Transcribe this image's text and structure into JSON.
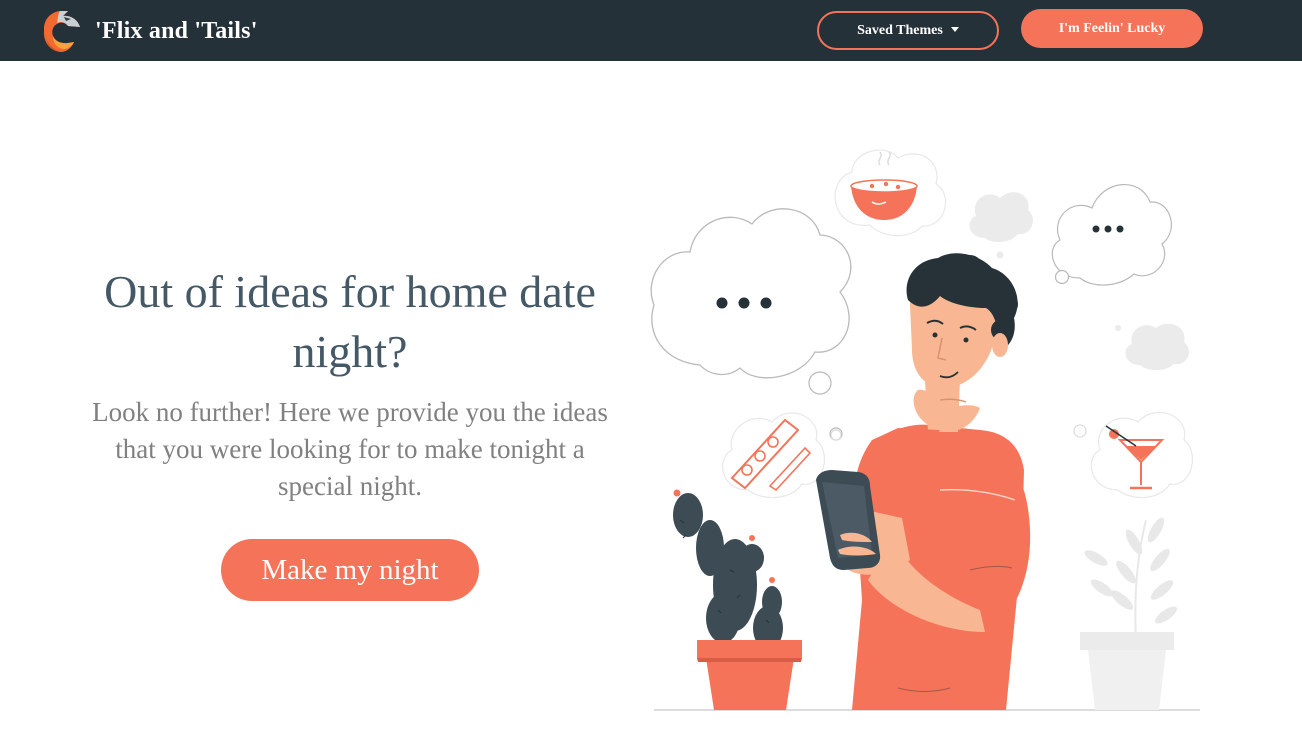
{
  "nav": {
    "brand": "'Flix and 'Tails'",
    "saved_themes": "Saved Themes",
    "lucky": "I'm Feelin' Lucky"
  },
  "hero": {
    "title": "Out of ideas for home date night?",
    "subtitle": "Look no further! Here we provide you the ideas that you were looking for to make tonight a special night.",
    "cta": "Make my night"
  },
  "colors": {
    "nav_bg": "#253138",
    "accent": "#f57359",
    "title": "#445866",
    "subtitle": "#808080"
  },
  "icons": {
    "logo": "fox-logo-icon",
    "dropdown": "caret-down-icon"
  }
}
